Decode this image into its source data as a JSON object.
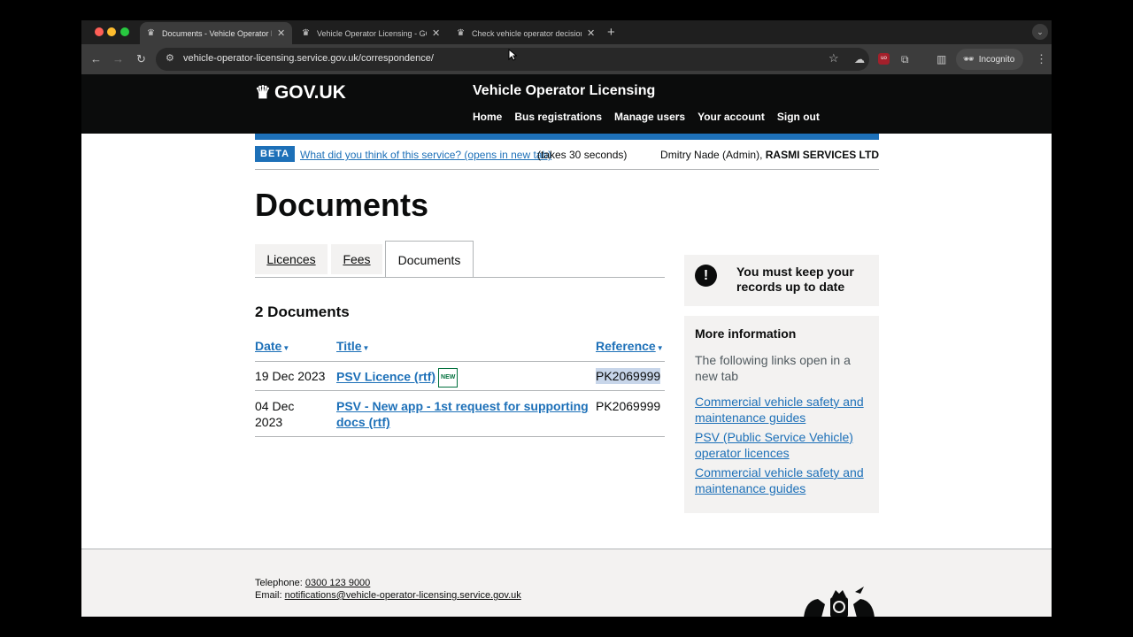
{
  "browser": {
    "tabs": [
      {
        "title": "Documents - Vehicle Operator Licensing",
        "active": true
      },
      {
        "title": "Vehicle Operator Licensing - GOV.UK",
        "active": false
      },
      {
        "title": "Check vehicle operator decisions",
        "active": false
      }
    ],
    "new_tab": "+",
    "url": "vehicle-operator-licensing.service.gov.uk/correspondence/",
    "incognito_label": "Incognito",
    "extension_badge": "uo"
  },
  "header": {
    "logo": "GOV.UK",
    "service_name": "Vehicle Operator Licensing",
    "nav": [
      "Home",
      "Bus registrations",
      "Manage users",
      "Your account",
      "Sign out"
    ]
  },
  "phase_banner": {
    "tag": "BETA",
    "feedback_link": "What did you think of this service? (opens in new tab)",
    "feedback_suffix": "(takes 30 seconds)",
    "user": "Dmitry Nade (Admin),",
    "organisation": "RASMI SERVICES LTD"
  },
  "page": {
    "title": "Documents",
    "tabs": [
      "Licences",
      "Fees",
      "Documents"
    ],
    "selected_tab": "Documents",
    "count_heading": "2 Documents"
  },
  "table": {
    "headers": {
      "date": "Date",
      "title": "Title",
      "reference": "Reference"
    },
    "rows": [
      {
        "date": "19 Dec 2023",
        "title": "PSV Licence (rtf)",
        "tag": "NEW",
        "reference": "PK2069999"
      },
      {
        "date_line1": "04 Dec",
        "date_line2": "2023",
        "title_line1": "PSV - New app - 1st request for supporting",
        "title_line2": "docs (rtf)",
        "reference": "PK2069999"
      }
    ]
  },
  "sidebar": {
    "warning_icon": "!",
    "warning": "You must keep your records up to date",
    "info_heading": "More information",
    "info_text": "The following links open in a new tab",
    "links": [
      "Commercial vehicle safety and maintenance guides",
      "PSV (Public Service Vehicle) operator licences",
      "Commercial vehicle safety and maintenance guides"
    ]
  },
  "footer": {
    "telephone_label": "Telephone:",
    "telephone": "0300 123 9000",
    "email_label": "Email:",
    "email": "notifications@vehicle-operator-licensing.service.gov.uk"
  },
  "colors": {
    "link": "#1d70b8",
    "header_bg": "#0b0c0c",
    "beta": "#1d70b8",
    "panel": "#f3f2f1"
  }
}
